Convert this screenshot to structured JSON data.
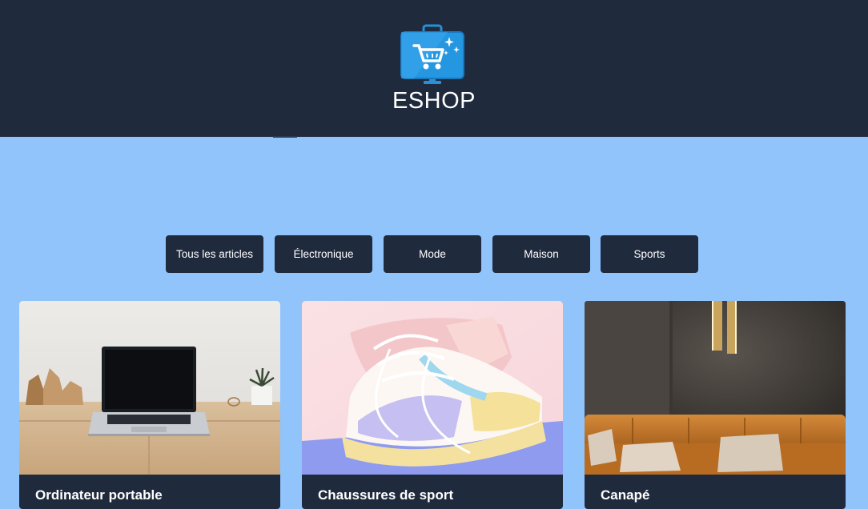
{
  "header": {
    "brand": "ESHOP",
    "logo_icon": "shopping-cart-bag-icon",
    "background": "#1f2a3d"
  },
  "filters": [
    {
      "label": "Tous les articles"
    },
    {
      "label": "Électronique"
    },
    {
      "label": "Mode"
    },
    {
      "label": "Maison"
    },
    {
      "label": "Sports"
    }
  ],
  "products": [
    {
      "title": "Ordinateur portable",
      "image": "laptop-photo"
    },
    {
      "title": "Chaussures de sport",
      "image": "sneaker-photo"
    },
    {
      "title": "Canapé",
      "image": "sofa-photo"
    }
  ],
  "colors": {
    "page_background": "#90c4fb",
    "dark": "#1f2a3d"
  }
}
